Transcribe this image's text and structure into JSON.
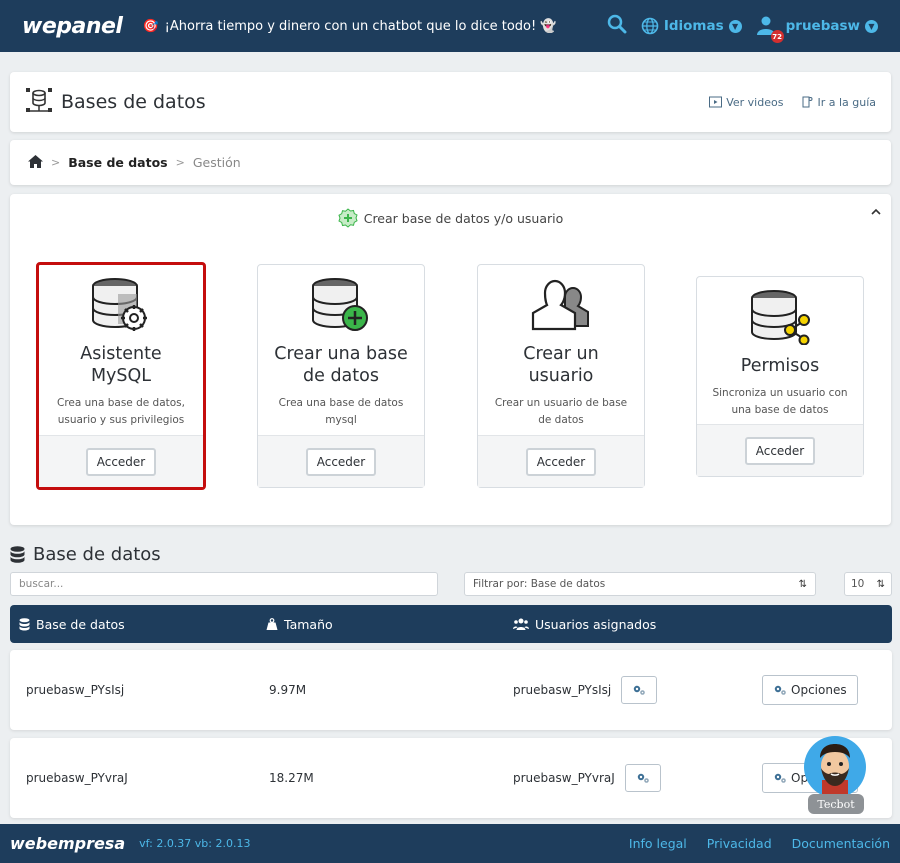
{
  "topbar": {
    "logo": "wepanel",
    "promo_emoji": "🎯",
    "promo_text": "¡Ahorra tiempo y dinero con un chatbot que lo dice todo! 👻",
    "languages_label": "Idiomas",
    "user_label": "pruebasw",
    "notifications_count": "72"
  },
  "header": {
    "title": "Bases de datos",
    "videos_label": "Ver videos",
    "guide_label": "Ir a la guía"
  },
  "breadcrumb": {
    "current": "Base de datos",
    "sub": "Gestión"
  },
  "create_section": {
    "title": "Crear base de datos y/o usuario",
    "options": [
      {
        "title": "Asistente MySQL",
        "desc": "Crea una base de datos, usuario y sus privilegios",
        "button": "Acceder",
        "selected": true
      },
      {
        "title": "Crear una base de datos",
        "desc": "Crea una base de datos mysql",
        "button": "Acceder"
      },
      {
        "title": "Crear un usuario",
        "desc": "Crear un usuario de base de datos",
        "button": "Acceder"
      },
      {
        "title": "Permisos",
        "desc": "Sincroniza un usuario con una base de datos",
        "button": "Acceder"
      }
    ]
  },
  "db_section": {
    "title": "Base de datos",
    "search_placeholder": "buscar...",
    "filter_label": "Filtrar por: Base de datos",
    "per_page": "10",
    "columns": [
      "Base de datos",
      "Tamaño",
      "Usuarios asignados"
    ],
    "rows": [
      {
        "name": "pruebasw_PYsIsj",
        "size": "9.97M",
        "user": "pruebasw_PYsIsj",
        "options": "Opciones"
      },
      {
        "name": "pruebasw_PYvraJ",
        "size": "18.27M",
        "user": "pruebasw_PYvraJ",
        "options": "Opciones"
      }
    ]
  },
  "footer": {
    "logo": "webempresa",
    "version": "vf: 2.0.37 vb: 2.0.13",
    "links": [
      "Info legal",
      "Privacidad",
      "Documentación"
    ]
  },
  "chatbot": {
    "label": "Tecbot"
  },
  "colors": {
    "navy": "#1e3d5c",
    "accent": "#4db8e8",
    "selected_border": "#c40d0d",
    "green": "#3bb54a"
  }
}
